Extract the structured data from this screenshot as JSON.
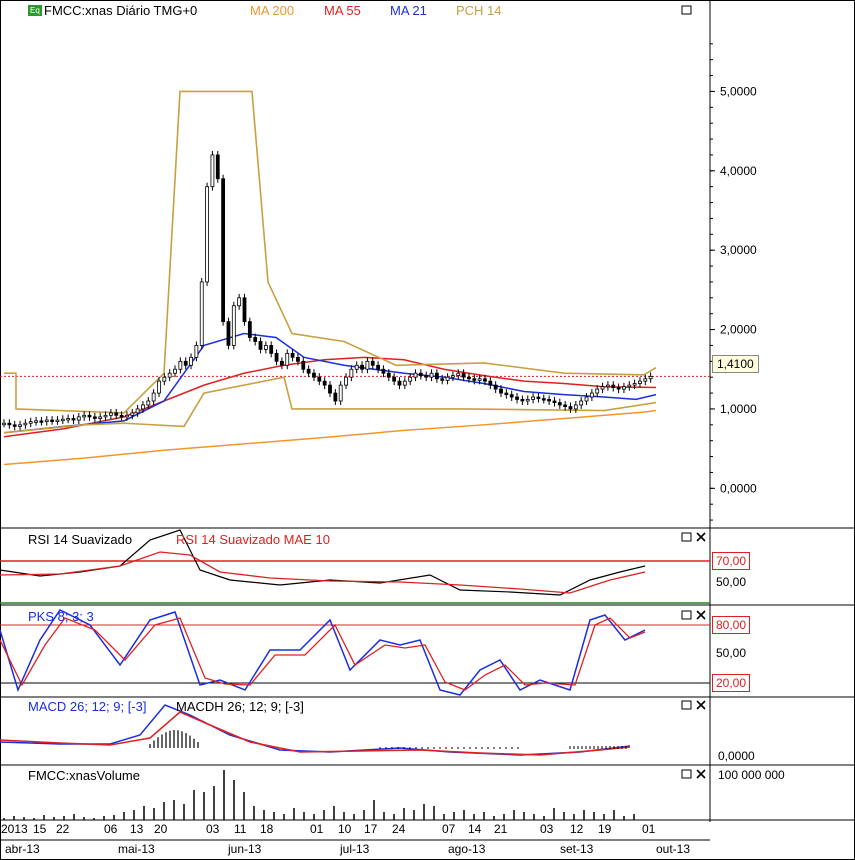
{
  "header": {
    "eq_badge": "Eq",
    "symbol": "FMCC:xnas Diário TMG+0",
    "ma200": "MA 200",
    "ma55": "MA 55",
    "ma21": "MA 21",
    "pch14": "PCH 14",
    "current_price": "1,4100"
  },
  "colors": {
    "ma200": "#f0962a",
    "ma55": "#e02020",
    "ma21": "#1a2ee0",
    "pch": "#c8a040",
    "candle_up": "#ffffff",
    "candle_down": "#000000"
  },
  "panels": {
    "rsi": {
      "label1": "RSI 14 Suavizado",
      "label2": "RSI 14 Suavizado MAE 10",
      "lvl_high": "70,00",
      "lvl_mid": "50,00"
    },
    "pks": {
      "label": "PKS 8; 3; 3",
      "lvl_high": "80,00",
      "lvl_mid": "50,00",
      "lvl_low": "20,00"
    },
    "macd": {
      "label1": "MACD 26; 12; 9; [-3]",
      "label2": "MACDH 26; 12; 9; [-3]",
      "lvl_zero": "0,0000"
    },
    "volume": {
      "label": "FMCC:xnasVolume",
      "lvl_top": "100 000 000"
    }
  },
  "x_axis": {
    "day_ticks": [
      "2013",
      "15",
      "22",
      "06",
      "13",
      "20",
      "03",
      "11",
      "18",
      "01",
      "10",
      "17",
      "24",
      "07",
      "14",
      "21",
      "03",
      "12",
      "19",
      "01"
    ],
    "months": [
      "abr-13",
      "mai-13",
      "jun-13",
      "jul-13",
      "ago-13",
      "set-13",
      "out-13"
    ]
  },
  "chart_data": {
    "type": "line",
    "title": "FMCC:xnas Diário TMG+0",
    "y_ticks": [
      "5,0000",
      "4,0000",
      "3,0000",
      "2,0000",
      "1,0000",
      "0,0000"
    ],
    "ylim": [
      -0.5,
      5.9
    ],
    "last_price": 1.41,
    "series": [
      {
        "name": "MA 200",
        "x": [
          0,
          20,
          40,
          60,
          80,
          100,
          120,
          140,
          160,
          163
        ],
        "values": [
          0.3,
          0.38,
          0.48,
          0.56,
          0.64,
          0.73,
          0.8,
          0.88,
          0.96,
          0.98
        ]
      },
      {
        "name": "MA 55",
        "x": [
          0,
          15,
          30,
          40,
          50,
          60,
          70,
          80,
          90,
          100,
          110,
          120,
          130,
          140,
          150,
          163
        ],
        "values": [
          0.65,
          0.75,
          0.9,
          1.1,
          1.3,
          1.45,
          1.55,
          1.62,
          1.65,
          1.62,
          1.5,
          1.42,
          1.35,
          1.32,
          1.28,
          1.27
        ]
      },
      {
        "name": "MA 21",
        "x": [
          0,
          15,
          30,
          40,
          50,
          60,
          68,
          75,
          85,
          100,
          110,
          120,
          130,
          140,
          150,
          158,
          163
        ],
        "values": [
          0.7,
          0.78,
          0.85,
          1.1,
          1.8,
          1.95,
          1.9,
          1.65,
          1.55,
          1.45,
          1.4,
          1.32,
          1.22,
          1.18,
          1.15,
          1.12,
          1.18
        ]
      }
    ]
  }
}
